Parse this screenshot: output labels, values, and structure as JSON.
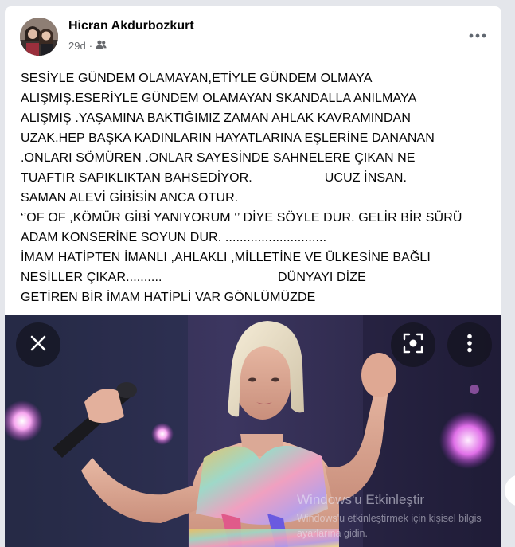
{
  "post": {
    "author": "Hicran Akdurbozkurt",
    "time": "29d",
    "separator": "·",
    "audience_icon": "friends-icon",
    "more_icon": "more-horizontal-icon",
    "text": "SESİYLE GÜNDEM OLAMAYAN,ETİYLE GÜNDEM OLMAYA\nALIŞMIŞ.ESERİYLE GÜNDEM OLAMAYAN SKANDALLA ANILMAYA\nALIŞMIŞ .YAŞAMINA BAKTIĞIMIZ ZAMAN AHLAK KAVRAMINDAN\nUZAK.HEP BAŞKA KADINLARIN HAYATLARINA EŞLERİNE DANANAN\n.ONLARI SÖMÜREN .ONLAR SAYESİNDE SAHNELERE ÇIKAN NE\nTUAFTIR SAPIKLIKTAN BAHSEDİYOR.                    UCUZ İNSAN.\nSAMAN ALEVİ GİBİSİN ANCA OTUR.\n‘’OF OF ,KÖMÜR GİBİ YANIYORUM ‘’ DİYE SÖYLE DUR. GELİR BİR SÜRÜ\nADAM KONSERİNE SOYUN DUR. ............................\nİMAM HATİPTEN İMANLI ,AHLAKLI ,MİLLETİNE VE ÜLKESİNE BAĞLI\nNESİLLER ÇIKAR..........                                DÜNYAYI DİZE\nGETİREN BİR İMAM HATİPLİ VAR GÖNLÜMÜZDE"
  },
  "photo_overlay": {
    "close_icon": "close-icon",
    "lens_icon": "image-search-icon",
    "menu_icon": "more-vertical-icon"
  },
  "watermark": {
    "title": "Windows'u Etkinleştir",
    "subtitle_line1": "Windows'u etkinleştirmek için kişisel bilgis",
    "subtitle_line2": "ayarlarına gidin."
  },
  "colors": {
    "page_bg": "#e4e6eb",
    "card_bg": "#ffffff",
    "text_primary": "#050505",
    "text_secondary": "#65676b"
  }
}
